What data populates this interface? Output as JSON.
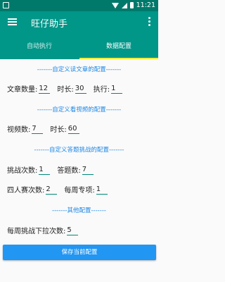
{
  "status": {
    "time": "11:21"
  },
  "app": {
    "title": "旺仔助手"
  },
  "tabs": [
    {
      "label": "自动执行"
    },
    {
      "label": "数据配置"
    }
  ],
  "sections": {
    "article": "-------自定义读文章的配置-------",
    "video": "-------自定义看视频的配置-------",
    "quiz": "-------自定义答题挑战的配置-------",
    "other": "-------其他配置-------"
  },
  "fields": {
    "article_count": {
      "label": "文章数量:",
      "value": "12"
    },
    "article_duration": {
      "label": "时长:",
      "value": "30"
    },
    "article_exec": {
      "label": "执行:",
      "value": "1"
    },
    "video_count": {
      "label": "视频数:",
      "value": "7"
    },
    "video_duration": {
      "label": "时长:",
      "value": "60"
    },
    "challenge_count": {
      "label": "挑战次数:",
      "value": "1"
    },
    "answer_count": {
      "label": "答题数:",
      "value": "7"
    },
    "four_player_count": {
      "label": "四人赛次数:",
      "value": "2"
    },
    "weekly_special": {
      "label": "每周专项:",
      "value": "1"
    },
    "weekly_scroll": {
      "label": "每周挑战下拉次数:",
      "value": "5"
    }
  },
  "save_button": {
    "label": "保存当前配置"
  }
}
